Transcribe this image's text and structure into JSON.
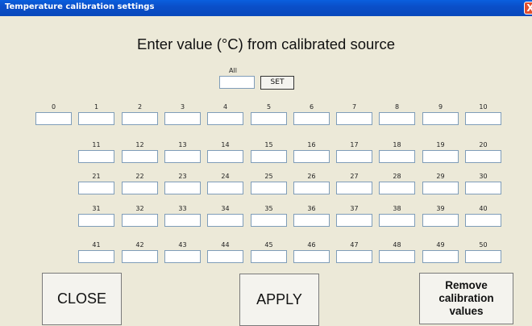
{
  "window": {
    "title": "Temperature calibration settings",
    "close_glyph": "X"
  },
  "heading": "Enter value (°C) from calibrated source",
  "all_control": {
    "label": "All",
    "value": "",
    "set_label": "SET"
  },
  "channels": {
    "row0": [
      "0",
      "1",
      "2",
      "3",
      "4",
      "5",
      "6",
      "7",
      "8",
      "9",
      "10"
    ],
    "row1": [
      "11",
      "12",
      "13",
      "14",
      "15",
      "16",
      "17",
      "18",
      "19",
      "20"
    ],
    "row2": [
      "21",
      "22",
      "23",
      "24",
      "25",
      "26",
      "27",
      "28",
      "29",
      "30"
    ],
    "row3": [
      "31",
      "32",
      "33",
      "34",
      "35",
      "36",
      "37",
      "38",
      "39",
      "40"
    ],
    "row4": [
      "41",
      "42",
      "43",
      "44",
      "45",
      "46",
      "47",
      "48",
      "49",
      "50"
    ]
  },
  "buttons": {
    "close": "CLOSE",
    "apply": "APPLY",
    "remove_line1": "Remove",
    "remove_line2": "calibration",
    "remove_line3": "values"
  }
}
